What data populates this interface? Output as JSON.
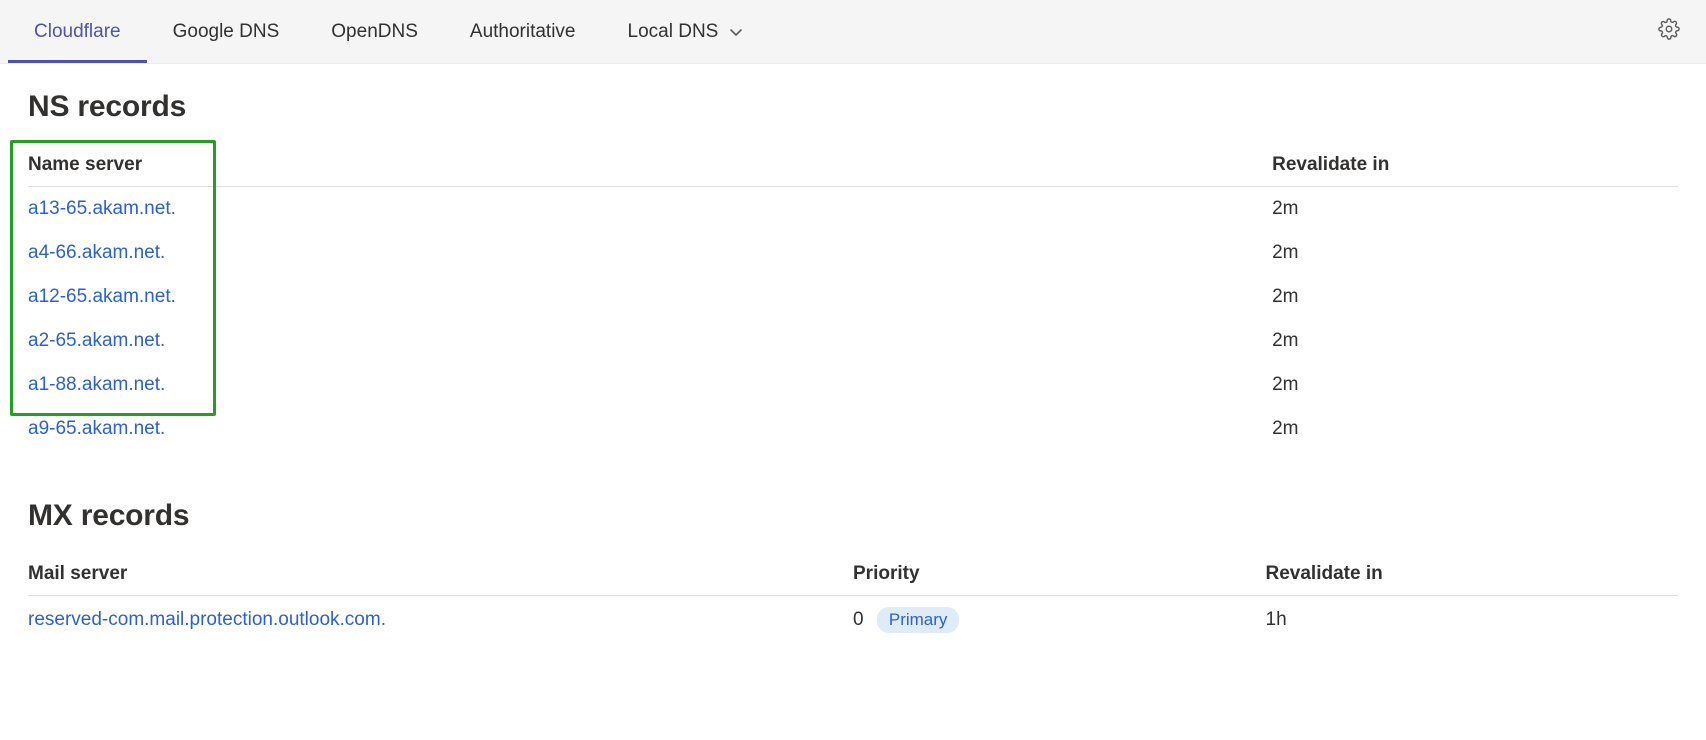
{
  "tabs": [
    {
      "label": "Cloudflare",
      "active": true,
      "hasDropdown": false
    },
    {
      "label": "Google DNS",
      "active": false,
      "hasDropdown": false
    },
    {
      "label": "OpenDNS",
      "active": false,
      "hasDropdown": false
    },
    {
      "label": "Authoritative",
      "active": false,
      "hasDropdown": false
    },
    {
      "label": "Local DNS",
      "active": false,
      "hasDropdown": true
    }
  ],
  "ns": {
    "title": "NS records",
    "headers": {
      "name": "Name server",
      "revalidate": "Revalidate in"
    },
    "rows": [
      {
        "server": "a13-65.akam.net.",
        "revalidate": "2m"
      },
      {
        "server": "a4-66.akam.net.",
        "revalidate": "2m"
      },
      {
        "server": "a12-65.akam.net.",
        "revalidate": "2m"
      },
      {
        "server": "a2-65.akam.net.",
        "revalidate": "2m"
      },
      {
        "server": "a1-88.akam.net.",
        "revalidate": "2m"
      },
      {
        "server": "a9-65.akam.net.",
        "revalidate": "2m"
      }
    ]
  },
  "mx": {
    "title": "MX records",
    "headers": {
      "server": "Mail server",
      "priority": "Priority",
      "revalidate": "Revalidate in"
    },
    "rows": [
      {
        "server": "reserved-com.mail.protection.outlook.com.",
        "priority": "0",
        "badge": "Primary",
        "revalidate": "1h"
      }
    ]
  }
}
